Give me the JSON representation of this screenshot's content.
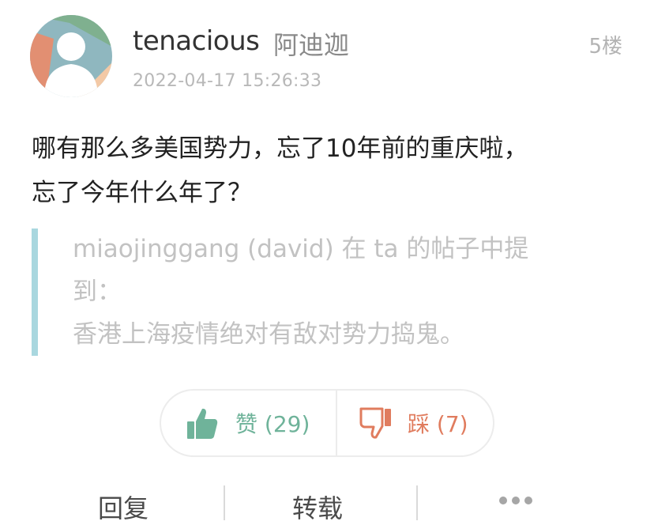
{
  "post": {
    "username": "tenacious",
    "nickname": "阿迪迦",
    "floor": "5楼",
    "timestamp": "2022-04-17 15:26:33",
    "content_line1": "哪有那么多美国势力，忘了10年前的重庆啦，",
    "content_line2": "忘了今年什么年了？",
    "quote": {
      "line1": "miaojinggang (david) 在 ta 的帖子中提",
      "line2": "到：",
      "line3": "香港上海疫情绝对有敌对势力捣鬼。"
    }
  },
  "votes": {
    "like_label": "赞 (29)",
    "dislike_label": "踩 (7)",
    "like_count": 29,
    "dislike_count": 7,
    "like_color": "#6fb39a",
    "dislike_color": "#e07c5e"
  },
  "actions": {
    "reply": "回复",
    "repost": "转载",
    "more_icon": "ellipsis-icon"
  },
  "icons": {
    "avatar": "default-user-avatar",
    "like": "thumbs-up-icon",
    "dislike": "thumbs-down-icon"
  }
}
